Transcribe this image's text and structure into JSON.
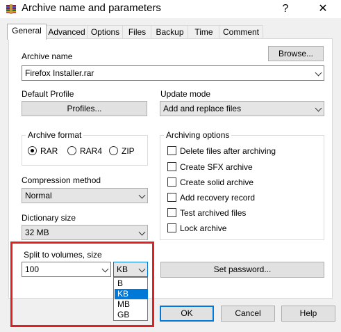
{
  "window": {
    "title": "Archive name and parameters",
    "help_glyph": "?",
    "close_glyph": "✕"
  },
  "tabs": [
    {
      "label": "General"
    },
    {
      "label": "Advanced"
    },
    {
      "label": "Options"
    },
    {
      "label": "Files"
    },
    {
      "label": "Backup"
    },
    {
      "label": "Time"
    },
    {
      "label": "Comment"
    }
  ],
  "general": {
    "archive_name_label": "Archive name",
    "browse_label": "Browse...",
    "archive_name_value": "Firefox Installer.rar",
    "default_profile_label": "Default Profile",
    "profiles_label": "Profiles...",
    "update_mode_label": "Update mode",
    "update_mode_value": "Add and replace files",
    "archive_format_label": "Archive format",
    "formats": [
      {
        "label": "RAR",
        "checked": true
      },
      {
        "label": "RAR4",
        "checked": false
      },
      {
        "label": "ZIP",
        "checked": false
      }
    ],
    "archiving_options_label": "Archiving options",
    "options": [
      {
        "label": "Delete files after archiving"
      },
      {
        "label": "Create SFX archive"
      },
      {
        "label": "Create solid archive"
      },
      {
        "label": "Add recovery record"
      },
      {
        "label": "Test archived files"
      },
      {
        "label": "Lock archive"
      }
    ],
    "compression_method_label": "Compression method",
    "compression_method_value": "Normal",
    "dictionary_size_label": "Dictionary size",
    "dictionary_size_value": "32 MB",
    "split_label": "Split to volumes, size",
    "split_value": "100",
    "split_unit_value": "KB",
    "split_units": [
      "B",
      "KB",
      "MB",
      "GB"
    ],
    "split_unit_selected": "KB",
    "set_password_label": "Set password..."
  },
  "buttons": {
    "ok": "OK",
    "cancel": "Cancel",
    "help": "Help"
  },
  "colors": {
    "highlight": "#e02020",
    "selection": "#0078d7"
  }
}
